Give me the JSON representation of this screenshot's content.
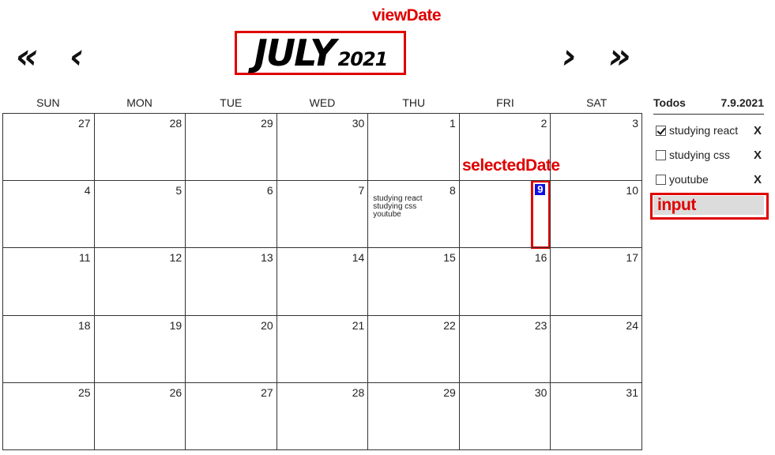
{
  "annotations": {
    "view_date": "viewDate",
    "selected_date": "selectedDate",
    "input": "input"
  },
  "header": {
    "prev_year": "«",
    "prev_month": "‹",
    "month": "JULY",
    "year": "2021",
    "next_month": "›",
    "next_year": "»"
  },
  "weekdays": [
    "SUN",
    "MON",
    "TUE",
    "WED",
    "THU",
    "FRI",
    "SAT"
  ],
  "calendar": {
    "days": [
      "27",
      "28",
      "29",
      "30",
      "1",
      "2",
      "3",
      "4",
      "5",
      "6",
      "7",
      "8",
      "9",
      "10",
      "11",
      "12",
      "13",
      "14",
      "15",
      "16",
      "17",
      "18",
      "19",
      "20",
      "21",
      "22",
      "23",
      "24",
      "25",
      "26",
      "27",
      "28",
      "29",
      "30",
      "31"
    ],
    "selected_index": 12,
    "cell_todos": {
      "11": [
        "studying react",
        "studying css",
        "youtube"
      ]
    }
  },
  "todos": {
    "title": "Todos",
    "date": "7.9.2021",
    "items": [
      {
        "text": "studying react",
        "checked": true,
        "delete": "X"
      },
      {
        "text": "studying css",
        "checked": false,
        "delete": "X"
      },
      {
        "text": "youtube",
        "checked": false,
        "delete": "X"
      }
    ],
    "input_value": "",
    "input_placeholder": ""
  },
  "colors": {
    "annotation": "#e00000",
    "selected_bg": "#1010e0",
    "input_bg": "#dcdcdc"
  }
}
